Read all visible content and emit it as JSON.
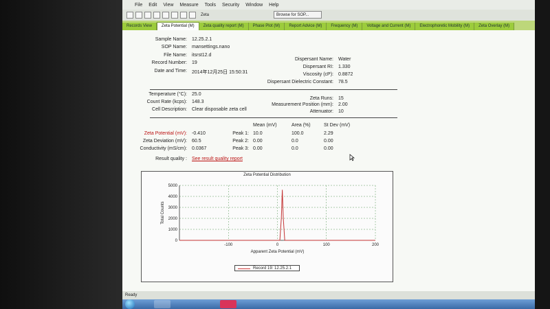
{
  "menu": [
    "File",
    "Edit",
    "View",
    "Measure",
    "Tools",
    "Security",
    "Window",
    "Help"
  ],
  "toolbar": {
    "zeta_label": "Zeta",
    "sop_button": "Browse for SOP..."
  },
  "tabs": [
    "Records View",
    "Zeta Potential (M)",
    "Zeta quality report (M)",
    "Phase Plot (M)",
    "Report Advice (M)",
    "Frequency (M)",
    "Voltage and Current (M)",
    "Electrophoretic Mobility (M)",
    "Zeta Overlay (M)"
  ],
  "record": {
    "sample_name_label": "Sample Name:",
    "sample_name": "12.25.2.1",
    "sop_name_label": "SOP Name:",
    "sop_name": "mansettings.nano",
    "file_name_label": "File Name:",
    "file_name": "itsrst12.d",
    "record_number_label": "Record Number:",
    "record_number": "19",
    "date_time_label": "Date and Time:",
    "date_time": "2014年12月25日 15:50:31"
  },
  "dispersant": {
    "name_label": "Dispersant Name:",
    "name": "Water",
    "ri_label": "Dispersant RI:",
    "ri": "1.330",
    "viscosity_label": "Viscosity (cP):",
    "viscosity": "0.8872",
    "dielectric_label": "Dispersant Dielectric Constant:",
    "dielectric": "78.5"
  },
  "conditions": {
    "temperature_label": "Temperature (°C):",
    "temperature": "25.0",
    "count_rate_label": "Count Rate (kcps):",
    "count_rate": "148.3",
    "cell_label": "Cell Description:",
    "cell": "Clear disposable zeta cell",
    "zeta_runs_label": "Zeta Runs:",
    "zeta_runs": "15",
    "position_label": "Measurement Position (mm):",
    "position": "2.00",
    "attenuator_label": "Attenuator:",
    "attenuator": "10"
  },
  "results": {
    "header_mean": "Mean (mV)",
    "header_area": "Area (%)",
    "header_stdev": "St Dev (mV)",
    "zeta_potential_label": "Zeta Potential (mV):",
    "zeta_potential": "-0.410",
    "zeta_deviation_label": "Zeta Deviation (mV):",
    "zeta_deviation": "60.5",
    "conductivity_label": "Conductivity (mS/cm):",
    "conductivity": "0.0367",
    "peaks": [
      {
        "label": "Peak 1:",
        "mean": "10.0",
        "area": "100.0",
        "stdev": "2.29"
      },
      {
        "label": "Peak 2:",
        "mean": "0.00",
        "area": "0.0",
        "stdev": "0.00"
      },
      {
        "label": "Peak 3:",
        "mean": "0.00",
        "area": "0.0",
        "stdev": "0.00"
      }
    ],
    "quality_label": "Result quality :",
    "quality_link": "See result quality report"
  },
  "chart_data": {
    "type": "line",
    "title": "Zeta Potential Distribution",
    "xlabel": "Apparent Zeta Potential (mV)",
    "ylabel": "Total Counts",
    "xlim": [
      -200,
      200
    ],
    "ylim": [
      0,
      5000
    ],
    "xticks": [
      -100,
      0,
      100,
      200
    ],
    "yticks": [
      0,
      1000,
      2000,
      3000,
      4000,
      5000
    ],
    "grid": true,
    "legend": "bottom-center",
    "series": [
      {
        "name": "Record 19: 12.25.2.1",
        "color": "#c33333",
        "x": [
          -200,
          0,
          5,
          8,
          10,
          12,
          15,
          20,
          200
        ],
        "y": [
          0,
          0,
          0,
          2000,
          4600,
          2000,
          0,
          0,
          0
        ]
      }
    ]
  },
  "status": {
    "text": "Ready"
  }
}
